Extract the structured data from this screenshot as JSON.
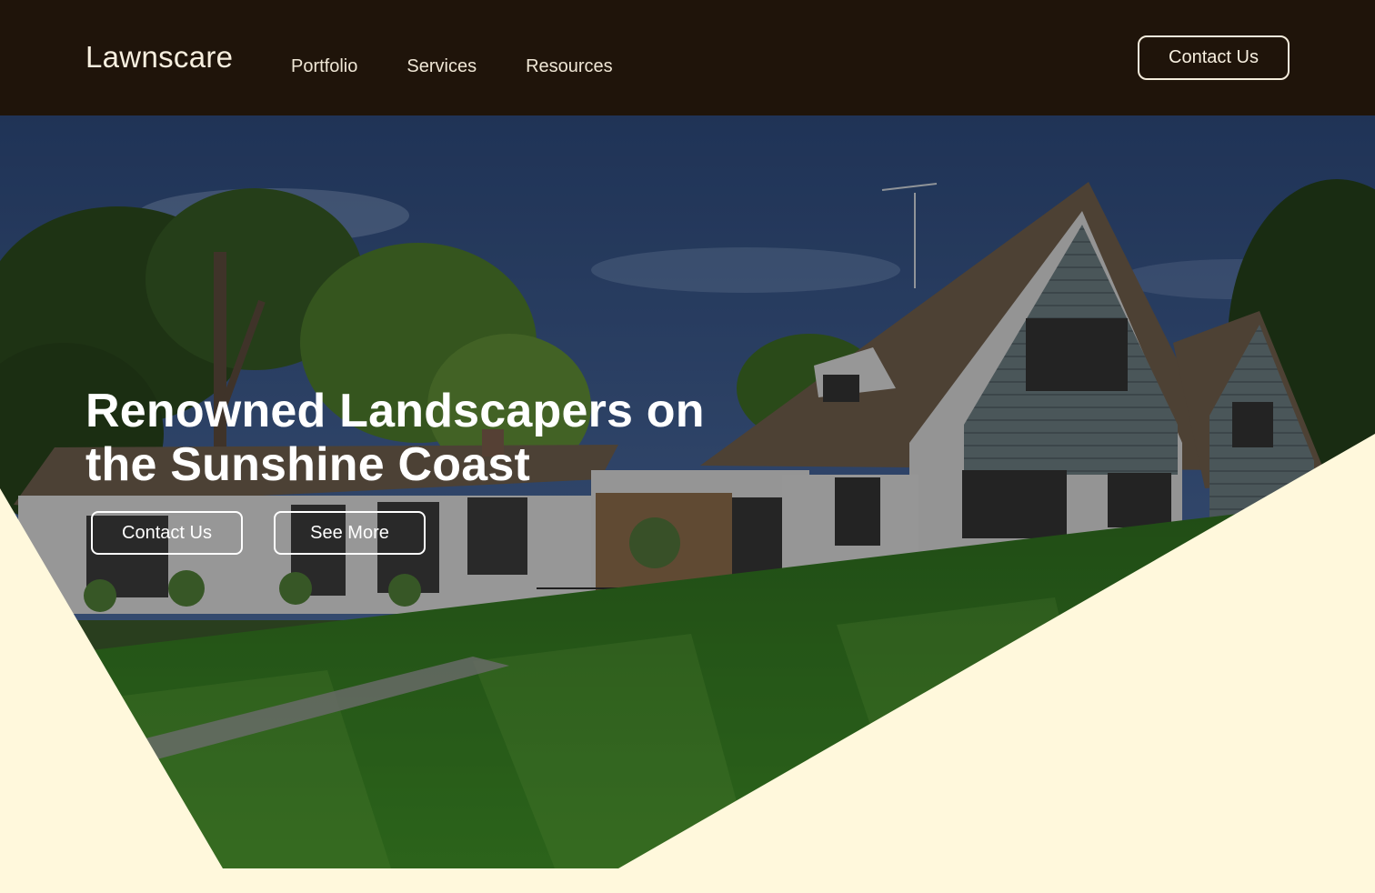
{
  "nav": {
    "brand": "Lawnscare",
    "links": [
      "Portfolio",
      "Services",
      "Resources"
    ],
    "cta": "Contact Us"
  },
  "hero": {
    "title": "Renowned Landscapers on the Sunshine Coast",
    "buttons": [
      "Contact Us",
      "See More"
    ],
    "image_alt": "Large white house with steep roof, trees and a striped green lawn under a blue sky"
  },
  "colors": {
    "nav_bg": "#1f140a",
    "cream": "#fff8dc",
    "text_light": "#f7efdf"
  }
}
